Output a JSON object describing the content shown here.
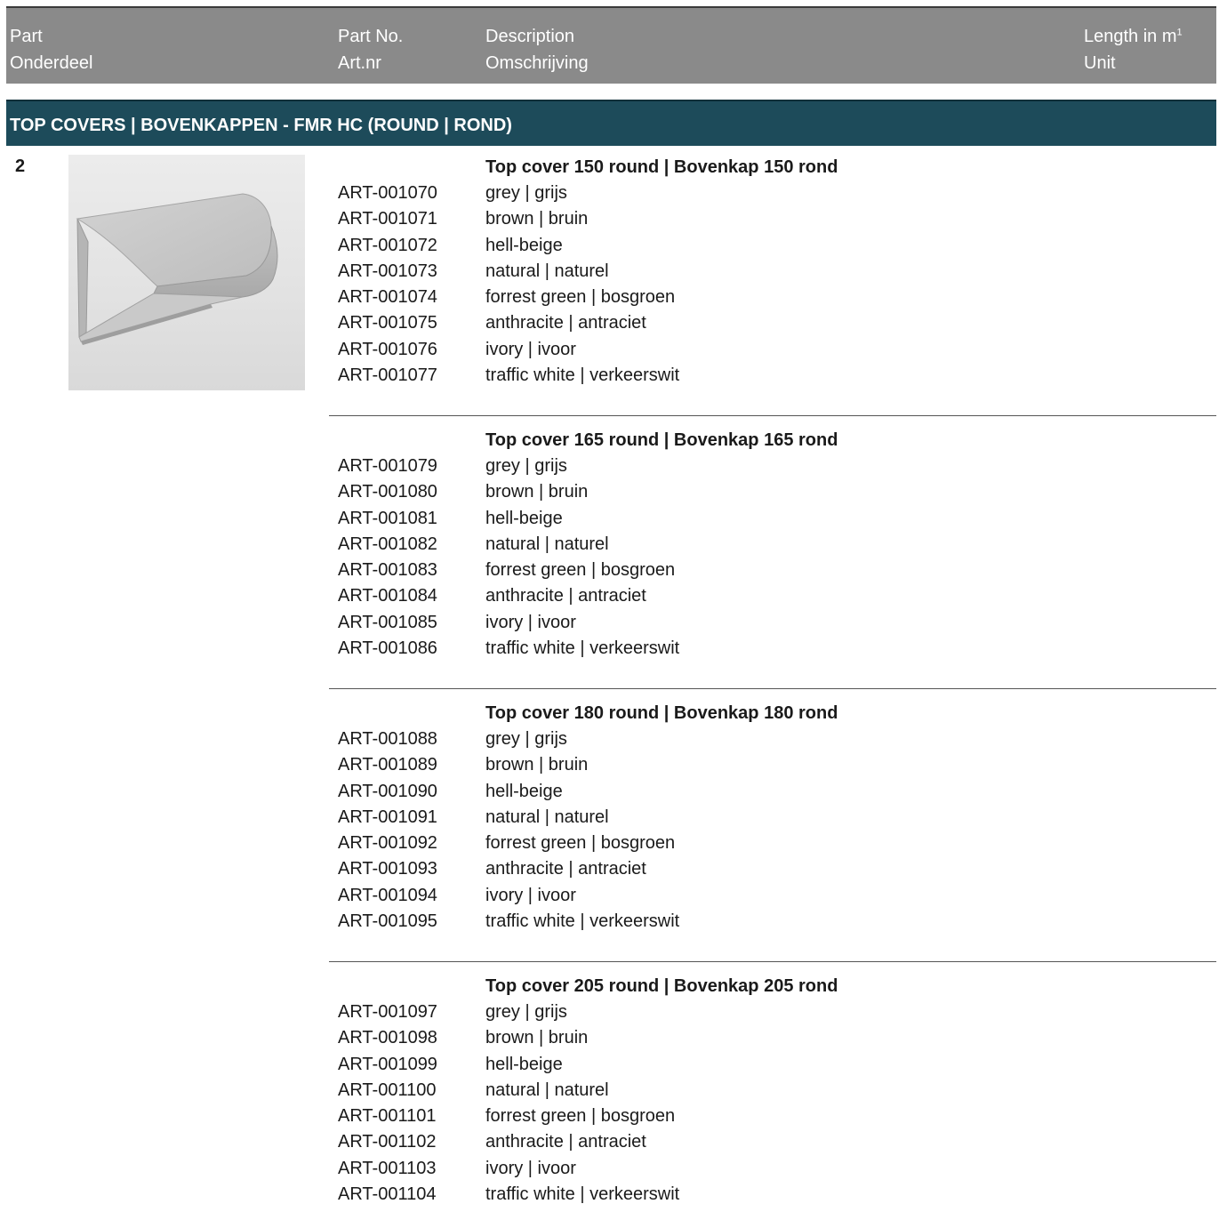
{
  "header": {
    "part_en": "Part",
    "part_nl": "Onderdeel",
    "partno_en": "Part No.",
    "partno_nl": "Art.nr",
    "desc_en": "Description",
    "desc_nl": "Omschrijving",
    "unit_en": "Length in m",
    "unit_sup": "1",
    "unit_nl": "Unit"
  },
  "section": {
    "title": "TOP COVERS | BOVENKAPPEN - FMR HC (ROUND | ROND)"
  },
  "part": {
    "number": "2",
    "image_alt": "top-cover-round-image"
  },
  "groups": [
    {
      "title": "Top cover 150 round | Bovenkap 150 rond",
      "items": [
        {
          "art": "ART-001070",
          "color": "grey | grijs"
        },
        {
          "art": "ART-001071",
          "color": "brown | bruin"
        },
        {
          "art": "ART-001072",
          "color": "hell-beige"
        },
        {
          "art": "ART-001073",
          "color": "natural | naturel"
        },
        {
          "art": "ART-001074",
          "color": "forrest green | bosgroen"
        },
        {
          "art": "ART-001075",
          "color": "anthracite | antraciet"
        },
        {
          "art": "ART-001076",
          "color": "ivory | ivoor"
        },
        {
          "art": "ART-001077",
          "color": "traffic white | verkeerswit"
        }
      ]
    },
    {
      "title": "Top cover 165 round | Bovenkap 165 rond",
      "items": [
        {
          "art": "ART-001079",
          "color": "grey | grijs"
        },
        {
          "art": "ART-001080",
          "color": "brown | bruin"
        },
        {
          "art": "ART-001081",
          "color": "hell-beige"
        },
        {
          "art": "ART-001082",
          "color": "natural | naturel"
        },
        {
          "art": "ART-001083",
          "color": "forrest green | bosgroen"
        },
        {
          "art": "ART-001084",
          "color": "anthracite | antraciet"
        },
        {
          "art": "ART-001085",
          "color": "ivory | ivoor"
        },
        {
          "art": "ART-001086",
          "color": "traffic white | verkeerswit"
        }
      ]
    },
    {
      "title": "Top cover 180 round | Bovenkap 180 rond",
      "items": [
        {
          "art": "ART-001088",
          "color": "grey | grijs"
        },
        {
          "art": "ART-001089",
          "color": "brown | bruin"
        },
        {
          "art": "ART-001090",
          "color": "hell-beige"
        },
        {
          "art": "ART-001091",
          "color": "natural | naturel"
        },
        {
          "art": "ART-001092",
          "color": "forrest green | bosgroen"
        },
        {
          "art": "ART-001093",
          "color": "anthracite | antraciet"
        },
        {
          "art": "ART-001094",
          "color": "ivory | ivoor"
        },
        {
          "art": "ART-001095",
          "color": "traffic white | verkeerswit"
        }
      ]
    },
    {
      "title": "Top cover 205 round | Bovenkap 205 rond",
      "items": [
        {
          "art": "ART-001097",
          "color": "grey | grijs"
        },
        {
          "art": "ART-001098",
          "color": "brown | bruin"
        },
        {
          "art": "ART-001099",
          "color": "hell-beige"
        },
        {
          "art": "ART-001100",
          "color": "natural | naturel"
        },
        {
          "art": "ART-001101",
          "color": "forrest green | bosgroen"
        },
        {
          "art": "ART-001102",
          "color": "anthracite | antraciet"
        },
        {
          "art": "ART-001103",
          "color": "ivory | ivoor"
        },
        {
          "art": "ART-001104",
          "color": "traffic white | verkeerswit"
        }
      ]
    }
  ],
  "colors": {
    "header_bg": "#8a8a8a",
    "section_bg": "#1d4b5a"
  }
}
